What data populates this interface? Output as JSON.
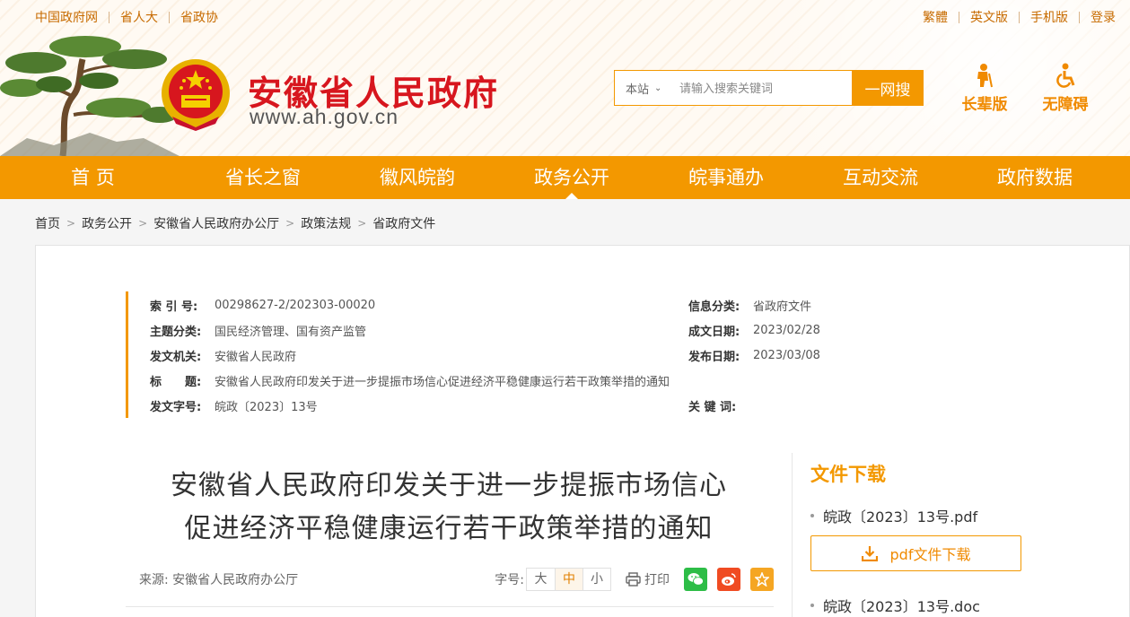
{
  "topbar": {
    "left_links": [
      "中国政府网",
      "省人大",
      "省政协"
    ],
    "right_links": [
      "繁體",
      "英文版",
      "手机版",
      "登录"
    ]
  },
  "header": {
    "site_title": "安徽省人民政府",
    "site_url": "www.ah.gov.cn",
    "search": {
      "scope": "本站",
      "placeholder": "请输入搜索关键词",
      "button": "一网搜"
    },
    "quick": {
      "elder": "长辈版",
      "accessible": "无障碍"
    }
  },
  "nav": {
    "items": [
      "首 页",
      "省长之窗",
      "徽风皖韵",
      "政务公开",
      "皖事通办",
      "互动交流",
      "政府数据"
    ],
    "active": "政务公开"
  },
  "breadcrumb": [
    "首页",
    "政务公开",
    "安徽省人民政府办公厅",
    "政策法规",
    "省政府文件"
  ],
  "meta": {
    "index_no": {
      "key": "索 引 号:",
      "value": "00298627-2/202303-00020"
    },
    "topic": {
      "key": "主题分类:",
      "value": "国民经济管理、国有资产监管"
    },
    "issuer": {
      "key": "发文机关:",
      "value": "安徽省人民政府"
    },
    "title": {
      "key": "标　　题:",
      "value": "安徽省人民政府印发关于进一步提振市场信心促进经济平稳健康运行若干政策举措的通知"
    },
    "doc_no": {
      "key": "发文字号:",
      "value": "皖政〔2023〕13号"
    },
    "info_category": {
      "key": "信息分类:",
      "value": "省政府文件"
    },
    "written_date": {
      "key": "成文日期:",
      "value": "2023/02/28"
    },
    "publish_date": {
      "key": "发布日期:",
      "value": "2023/03/08"
    },
    "keywords": {
      "key": "关 键 词:",
      "value": ""
    }
  },
  "article": {
    "title_line1": "安徽省人民政府印发关于进一步提振市场信心",
    "title_line2": "促进经济平稳健康运行若干政策举措的通知",
    "source": "来源:  安徽省人民政府办公厅",
    "font_size_label": "字号:",
    "font_sizes": [
      "大",
      "中",
      "小"
    ],
    "font_size_selected": "中",
    "print": "打印"
  },
  "downloads": {
    "title": "文件下载",
    "files": [
      "皖政〔2023〕13号.pdf",
      "皖政〔2023〕13号.doc"
    ],
    "pdf_button": "pdf文件下载"
  },
  "colors": {
    "accent": "#f39800",
    "title_red": "#d7161e",
    "wechat": "#2dbd47",
    "weibo": "#f04b22",
    "favorite": "#f5a623"
  }
}
